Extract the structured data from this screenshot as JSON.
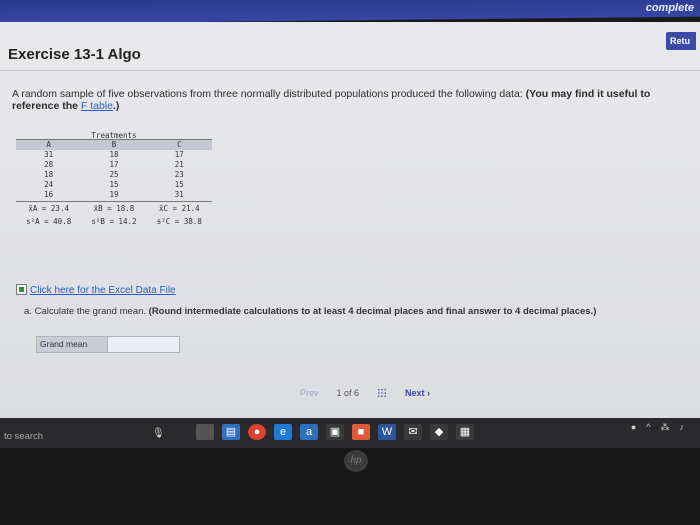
{
  "browser": {
    "top_right_text": "complete"
  },
  "header": {
    "return_label": "Retu",
    "title": "Exercise 13-1 Algo"
  },
  "prompt": {
    "text": "A random sample of five observations from three normally distributed populations produced the following data:",
    "bold_prefix": "(You may find it useful to reference the",
    "link": "F table",
    "bold_suffix": ".)"
  },
  "table": {
    "header": "Treatments",
    "columns": [
      "A",
      "B",
      "C"
    ],
    "rows": [
      [
        "31",
        "18",
        "17"
      ],
      [
        "28",
        "17",
        "21"
      ],
      [
        "18",
        "25",
        "23"
      ],
      [
        "24",
        "15",
        "15"
      ],
      [
        "16",
        "19",
        "31"
      ]
    ],
    "means": [
      "x̄A = 23.4",
      "x̄B = 18.8",
      "x̄C = 21.4"
    ],
    "variances": [
      "s²A = 40.8",
      "s²B = 14.2",
      "s²C = 38.8"
    ]
  },
  "excel_link": "Click here for the Excel Data File",
  "question": {
    "letter": "a.",
    "text": "Calculate the grand mean.",
    "instruction": "(Round intermediate calculations to at least 4 decimal places and final answer to 4 decimal places.)"
  },
  "answer": {
    "label": "Grand mean",
    "value": ""
  },
  "pager": {
    "prev": "Prev",
    "position": "1 of 6",
    "next": "Next"
  },
  "taskbar": {
    "search": "to search",
    "logo": "hp"
  }
}
